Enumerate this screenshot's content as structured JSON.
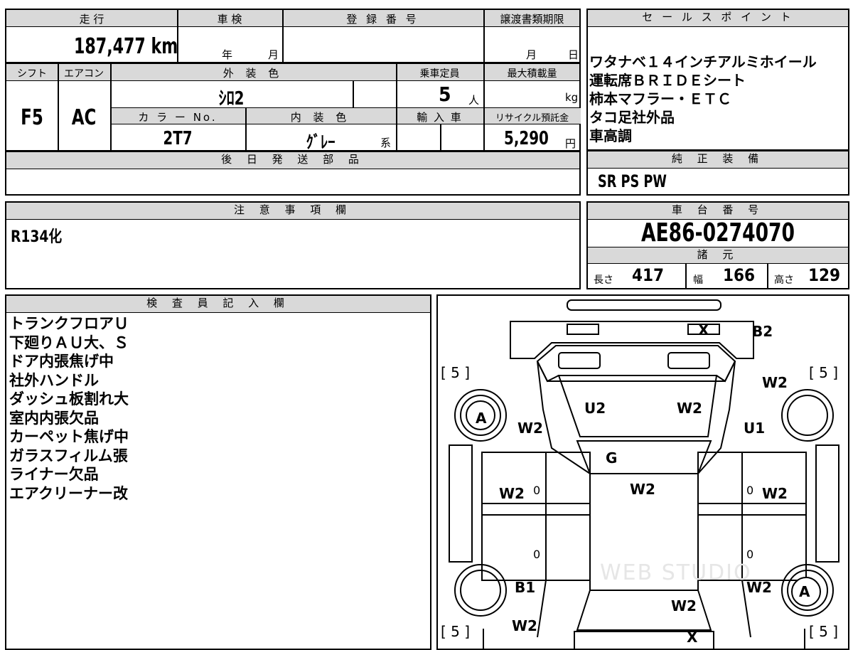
{
  "summary": {
    "headers": {
      "mileage": "走 行",
      "inspection": "車 検",
      "registration": "登 録 番 号",
      "transfer_deadline": "譲渡書類期限"
    },
    "mileage": "187,477",
    "mileage_unit": "km",
    "inspection_year_unit": "年",
    "inspection_month_unit": "月",
    "registration_number": "",
    "transfer_month_unit": "月",
    "transfer_day_unit": "日"
  },
  "specs": {
    "headers": {
      "shift": "シフト",
      "aircon": "エアコン",
      "exterior_color": "外 装 色",
      "capacity": "乗車定員",
      "max_load": "最大積載量",
      "color_no": "カ ラ ー No.",
      "interior_color": "内 装 色",
      "import": "輸 入 車",
      "recycle": "リサイクル預託金"
    },
    "shift": "F5",
    "aircon": "AC",
    "exterior_color": "ｼﾛ2",
    "capacity": "5",
    "capacity_unit": "人",
    "max_load_unit": "kg",
    "color_no": "2T7",
    "interior_color": "ｸﾞﾚｰ",
    "interior_suffix": "系",
    "recycle_fee": "5,290",
    "recycle_unit": "円"
  },
  "later_parts": {
    "header": "後 日 発 送 部 品",
    "text": ""
  },
  "notes": {
    "header": "注 意 事 項 欄",
    "text": "R134化"
  },
  "sales_points": {
    "header": "セ ー ル ス ポ イ ン ト",
    "lines": [
      "ワタナベ１４インチアルミホイール",
      "運転席ＢＲＩＤＥシート",
      "柿本マフラー・ＥＴＣ",
      "タコ足社外品",
      "車高調"
    ]
  },
  "standard_equipment": {
    "header": "純 正 装 備",
    "text": "SR PS PW"
  },
  "chassis": {
    "header": "車 台 番 号",
    "number": "AE86-0274070"
  },
  "dimensions": {
    "header": "諸 元",
    "length_label": "長さ",
    "length": "417",
    "width_label": "幅",
    "width": "166",
    "height_label": "高さ",
    "height": "129"
  },
  "inspector": {
    "header": "検 査 員 記 入 欄",
    "lines": [
      "トランクフロアＵ",
      "下廻りＡＵ大、Ｓ",
      "ドア内張焦げ中",
      "社外ハンドル",
      "ダッシュ板割れ大",
      "室内内張欠品",
      "カーペット焦げ中",
      "ガラスフィルム張",
      "ライナー欠品",
      "エアクリーナー改"
    ]
  },
  "diagram": {
    "marks": {
      "rear_trunk_x": "X",
      "rear_bumper": "B2",
      "tire_rl": "[ 5 ]",
      "tire_rr": "[ 5 ]",
      "tire_fl": "[ 5 ]",
      "tire_fr": "[ 5 ]",
      "rear_quarter_r": "W2",
      "rear_quarter_l": "W2",
      "wheel_l_rear": "A",
      "wheel_r_front": "A",
      "roof_rear_glass_l": "U2",
      "roof_rear_glass_r": "W2",
      "rear_fender_r": "U1",
      "glass_top": "G",
      "roof": "W2",
      "door_l": "W2",
      "door_r": "W2",
      "door_l_zero_top": "0",
      "door_r_zero_top": "0",
      "door_l_zero_bottom": "0",
      "door_r_zero_bottom": "0",
      "front_fender_l": "B1",
      "front_fender_r": "W2",
      "hood": "W2",
      "front_bumper_l": "W2",
      "front_x": "X"
    },
    "watermark": "WEB STUDIO"
  }
}
